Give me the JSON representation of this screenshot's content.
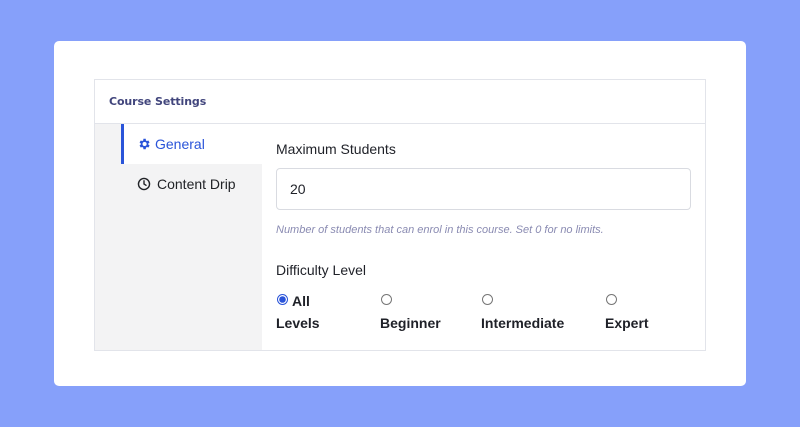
{
  "panel": {
    "title": "Course Settings"
  },
  "tabs": [
    {
      "label": "General",
      "icon": "gear-icon",
      "active": true
    },
    {
      "label": "Content Drip",
      "icon": "clock-icon",
      "active": false
    }
  ],
  "general": {
    "max_students_label": "Maximum Students",
    "max_students_value": "20",
    "max_students_hint": "Number of students that can enrol in this course. Set 0 for no limits.",
    "difficulty_label": "Difficulty Level",
    "difficulty_options": [
      {
        "label_line1": "All",
        "label_line2": "Levels",
        "selected": true
      },
      {
        "label": "Beginner",
        "selected": false
      },
      {
        "label": "Intermediate",
        "selected": false
      },
      {
        "label": "Expert",
        "selected": false
      }
    ]
  },
  "colors": {
    "background": "#86a0fa",
    "accent": "#2a54d9",
    "title": "#41457c",
    "hint": "#8a8bb2"
  }
}
